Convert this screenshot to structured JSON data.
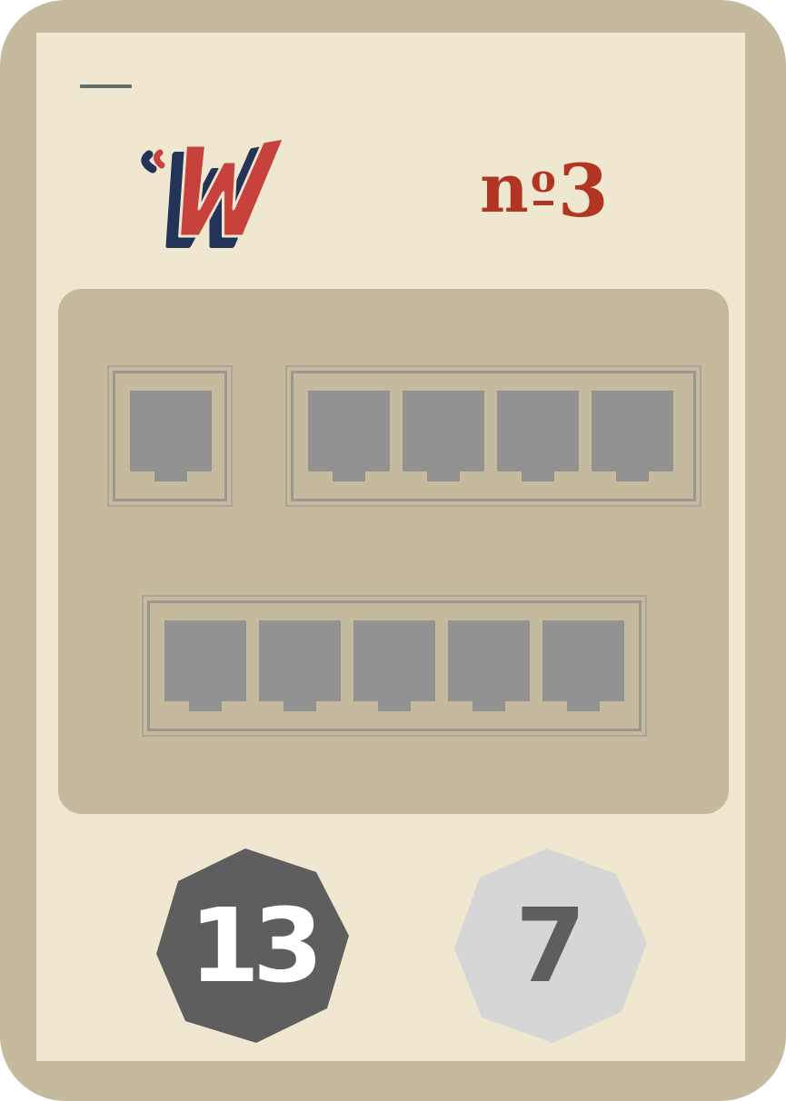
{
  "card": {
    "colors": {
      "border": "#c5b99e",
      "face": "#f0e7d0",
      "accent": "#b23524",
      "logo_navy": "#243358",
      "slot": "#929292"
    },
    "logo": {
      "icon": "w-logo-icon",
      "text": "W"
    },
    "number": {
      "prefix": "n",
      "ordinal": "o",
      "digit": "3"
    },
    "slot_groups": [
      {
        "slots": 1
      },
      {
        "slots": 4
      },
      {
        "slots": 5
      }
    ],
    "badges": [
      {
        "value": "13",
        "style": "dark",
        "color": "#5e5e5e"
      },
      {
        "value": "7",
        "style": "light",
        "color": "#d6d6d6"
      }
    ]
  }
}
